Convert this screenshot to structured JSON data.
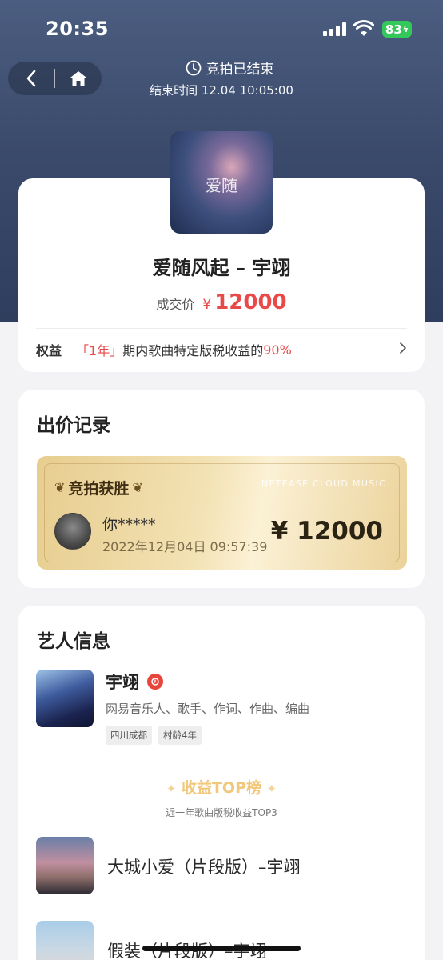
{
  "status_bar": {
    "time": "20:35",
    "battery": "83"
  },
  "header": {
    "auction_status": "竞拍已结束",
    "end_time_label": "结束时间",
    "end_time": "12.04 10:05:00"
  },
  "song": {
    "title": "爱随风起 – 宇翊",
    "cover_mark": "爱随",
    "deal_label": "成交价",
    "currency": "¥",
    "deal_price": "12000"
  },
  "rights": {
    "label": "权益",
    "period": "「1年」",
    "text": "期内歌曲特定版税收益的",
    "percent": "90%"
  },
  "bid_record": {
    "title": "出价记录",
    "winner_label": "竞拍获胜",
    "brand": "NETEASE  CLOUD  MUSIC",
    "bidder": "你*****",
    "time": "2022年12月04日  09:57:39",
    "amount": "¥ 12000"
  },
  "artist": {
    "section_title": "艺人信息",
    "name": "宇翊",
    "description": "网易音乐人、歌手、作词、作曲、编曲",
    "tags": [
      "四川成都",
      "村龄4年"
    ]
  },
  "top_list": {
    "title": "收益TOP榜",
    "subtitle": "近一年歌曲版税收益TOP3",
    "songs": [
      {
        "title": "大城小爱（片段版）–宇翊"
      },
      {
        "title": "假装（片段版）–宇翊"
      }
    ]
  }
}
